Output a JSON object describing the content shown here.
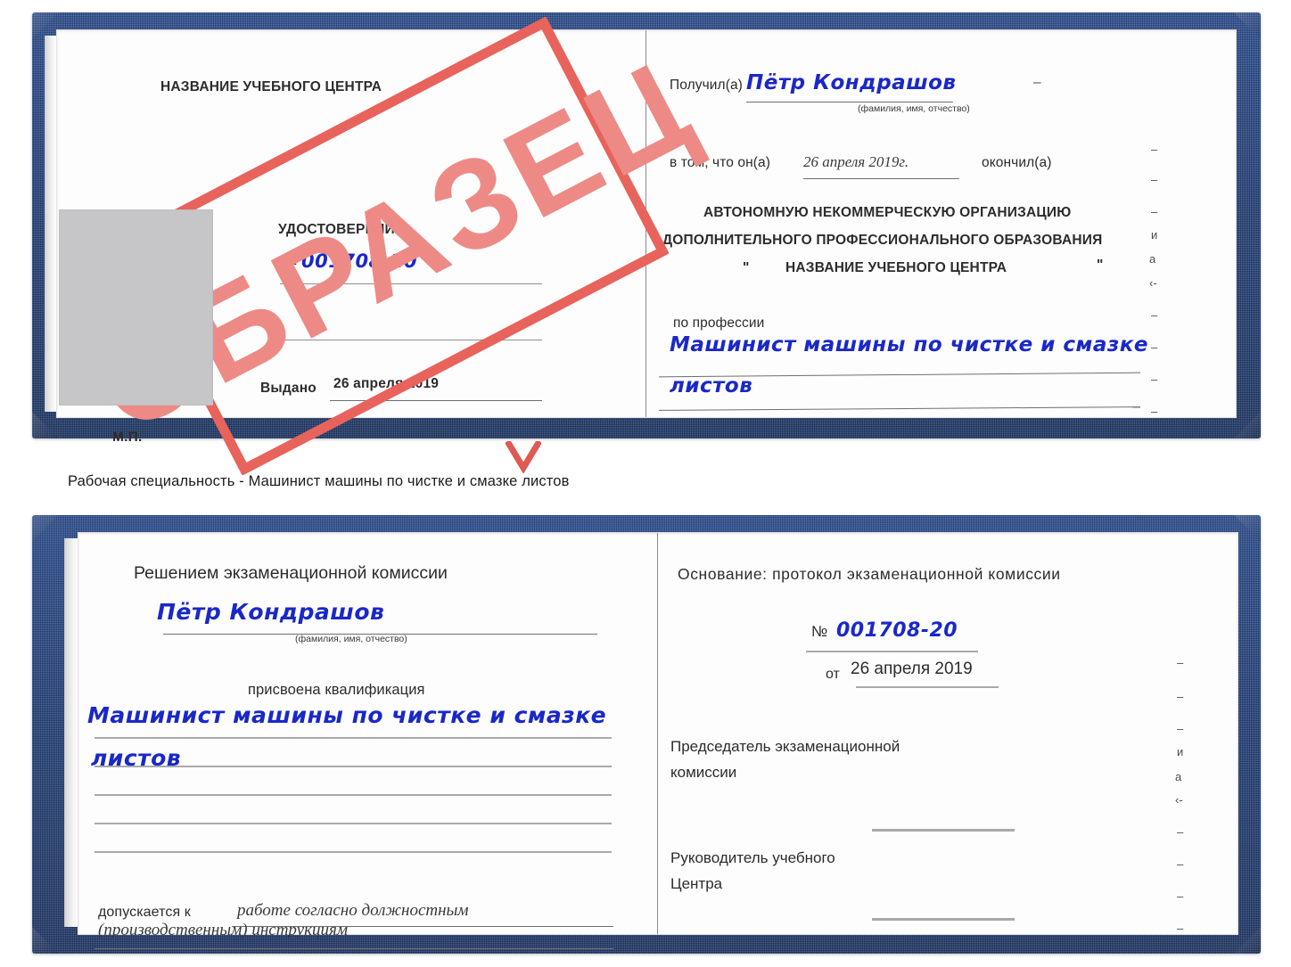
{
  "caption": "Рабочая специальность - Машинист машины по чистке и смазке листов",
  "stamp": {
    "text": "ОБРАЗЕЦ",
    "border_color": "#e8635c",
    "text_color": "#ee8a85"
  },
  "colors": {
    "cover_blue": "#23417c",
    "handwriting_blue": "#1a28c8",
    "rule_gray": "#8f8f8f"
  },
  "certificate_top": {
    "left_page": {
      "org_title": "НАЗВАНИЕ УЧЕБНОГО ЦЕНТРА",
      "doc_type": "УДОСТОВЕРЕНИЕ",
      "number_prefix": "№",
      "number_value": "001708-20",
      "issued_label": "Выдано",
      "issued_date": "26 апреля 2019",
      "seal_label": "М.П.",
      "photo_placeholder": "photo-box"
    },
    "right_page": {
      "received_label": "Получил(а)",
      "received_name": "Пётр Кондрашов",
      "name_hint": "(фамилия, имя, отчество)",
      "in_that_label": "в том, что он(а)",
      "completion_date": "26 апреля 2019г.",
      "finished_label": "окончил(а)",
      "org_line1": "АВТОНОМНУЮ НЕКОММЕРЧЕСКУЮ ОРГАНИЗАЦИЮ",
      "org_line2": "ДОПОЛНИТЕЛЬНОГО ПРОФЕССИОНАЛЬНОГО ОБРАЗОВАНИЯ",
      "org_quote_open": "\"",
      "org_line3": "НАЗВАНИЕ УЧЕБНОГО ЦЕНТРА",
      "org_quote_close": "\"",
      "profession_label": "по профессии",
      "profession_value_line1": "Машинист машины по чистке и смазке",
      "profession_value_line2": "листов",
      "edge_fragments": [
        "–",
        "–",
        "–",
        "и",
        "а",
        "‹-",
        "–",
        "–",
        "–",
        "–"
      ]
    }
  },
  "certificate_bottom": {
    "left_page": {
      "decision_title": "Решением экзаменационной комиссии",
      "name_value": "Пётр Кондрашов",
      "name_hint": "(фамилия, имя, отчество)",
      "qualification_label": "присвоена квалификация",
      "qualification_line1": "Машинист машины по чистке и смазке",
      "qualification_line2": "листов",
      "allowed_label": "допускается к",
      "allowed_value_line1": "работе согласно должностным",
      "allowed_value_line2": "(производственным) инструкциям"
    },
    "right_page": {
      "basis_label": "Основание: протокол экзаменационной комиссии",
      "protocol_number_prefix": "№",
      "protocol_number_value": "001708-20",
      "date_prefix": "от",
      "date_value": "26 апреля 2019",
      "chair_line1": "Председатель экзаменационной",
      "chair_line2": "комиссии",
      "head_line1": "Руководитель учебного",
      "head_line2": "Центра",
      "edge_fragments": [
        "–",
        "–",
        "–",
        "и",
        "а",
        "‹-",
        "–",
        "–",
        "–",
        "–"
      ]
    }
  }
}
